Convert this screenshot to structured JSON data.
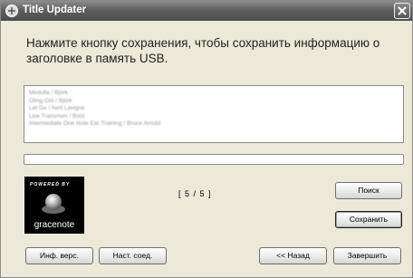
{
  "window": {
    "title": "Title Updater"
  },
  "heading": "Нажмите кнопку сохранения, чтобы сохранить информацию о заголовке в память USB.",
  "list": {
    "items": [
      "Medulla / Björk",
      "Gling-Gló / Björk",
      "Let Go / Avril Lavigne",
      "Live Transmen / Bold",
      "Intermediate One Note Ear Training / Bruce Arnold"
    ]
  },
  "progress": {
    "value": 0
  },
  "logo": {
    "powered_by": "POWERED BY",
    "brand": "gracenote"
  },
  "counter": "[ 5 / 5 ]",
  "buttons": {
    "search": "Поиск",
    "save": "Сохранить",
    "version_info": "Инф. верс.",
    "connection_settings": "Наст. соед.",
    "back": "<< Назад",
    "finish": "Завершить"
  },
  "colors": {
    "titlebar": "#5f5f5f",
    "dialog_background": "#ece9d8"
  },
  "icons": {
    "title": "app-icon",
    "close": "close-icon",
    "logo": "gracenote-logo"
  }
}
